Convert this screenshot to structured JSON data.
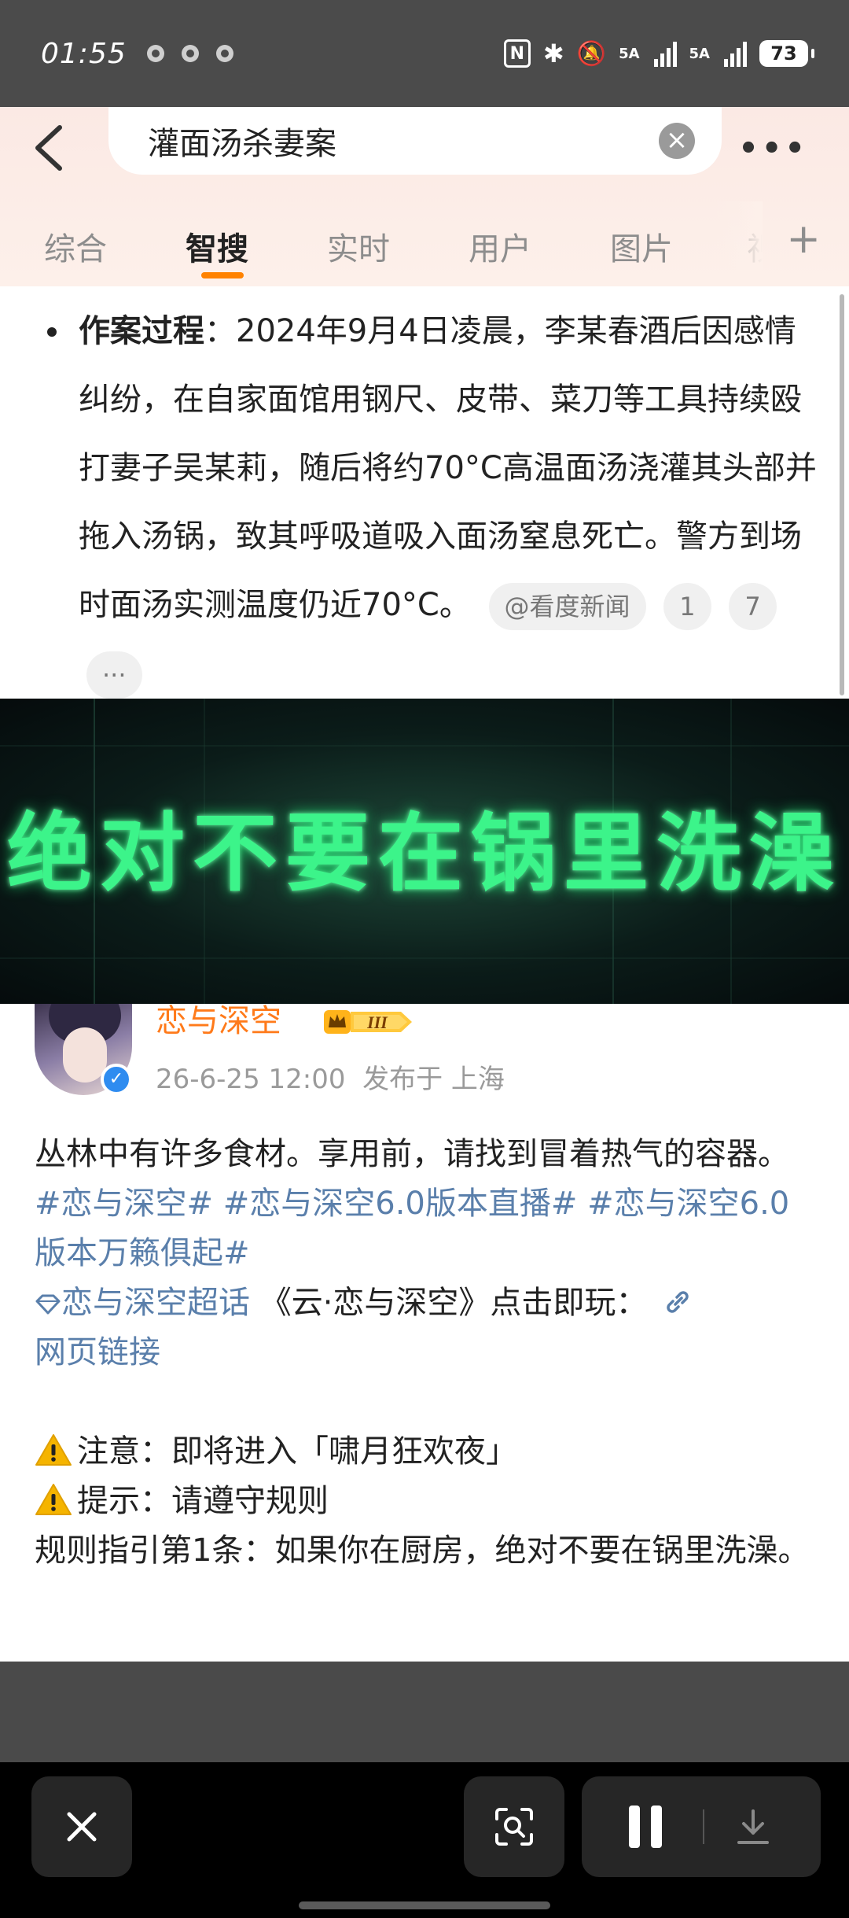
{
  "status_bar": {
    "time": "01:55",
    "nfc": "N",
    "sim1": "5A",
    "sim2": "5A",
    "battery": "73"
  },
  "search": {
    "query": "灌面汤杀妻案",
    "tabs": [
      "综合",
      "智搜",
      "实时",
      "用户",
      "图片",
      "视"
    ],
    "active_tab": "智搜",
    "accent_color": "#ff8200"
  },
  "article": {
    "heading": "作案过程",
    "body": "：2024年9月4日凌晨，李某春酒后因感情纠纷，在自家面馆用钢尺、皮带、菜刀等工具持续殴打妻子吴某莉，随后将约70°C高温面汤浇灌其头部并拖入汤锅，致其呼吸道吸入面汤窒息死亡。警方到场时面汤实测温度仍近70°C。",
    "source": "@看度新闻",
    "ref1": "1",
    "ref2": "7",
    "more": "···"
  },
  "banner": {
    "text": "绝对不要在锅里洗澡"
  },
  "post": {
    "author": "恋与深空",
    "level": "III",
    "timestamp": "26-6-25 12:00",
    "location": "发布于 上海",
    "line1": "丛林中有许多食材。享用前，请找到冒着热气的容器。",
    "hashtags": "#恋与深空# #恋与深空6.0版本直播# #恋与深空6.0版本万籁俱起#",
    "supertopic": "恋与深空超话",
    "play_text": "《云·恋与深空》点击即玩：",
    "web_link": "网页链接",
    "notice": "注意：即将进入「啸月狂欢夜」",
    "tip": "提示：请遵守规则",
    "rule": "规则指引第1条：如果你在厨房，绝对不要在锅里洗澡。"
  }
}
